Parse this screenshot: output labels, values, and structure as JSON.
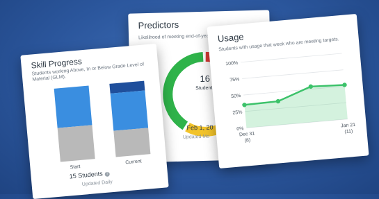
{
  "predictors": {
    "title": "Predictors",
    "subtitle": "Likelihood of meeting end-of-year, p benchmark.",
    "center_value": "16",
    "center_label": "Students",
    "date": "Feb 1, 20",
    "updated": "Updated Mo",
    "colors": {
      "green": "#2fb34a",
      "yellow": "#f2c32a",
      "red": "#d93b35"
    }
  },
  "usage": {
    "title": "Usage",
    "subtitle": "Students with usage that week who are meeting targets.",
    "chart_data": {
      "type": "area",
      "y_ticks": [
        "100%",
        "75%",
        "50%",
        "25%",
        "0%"
      ],
      "ylim": [
        0,
        100
      ],
      "x_labels": [
        {
          "date": "Dec 31",
          "count": "(8)"
        },
        {
          "date": "Jan 21",
          "count": "(11)"
        }
      ],
      "series": [
        {
          "values": [
            35,
            36,
            54,
            52
          ]
        }
      ],
      "color": "#3cc26a"
    }
  },
  "skill": {
    "title": "Skill Progress",
    "subtitle": "Students working Above, In or Below Grade Level of Material (GLM).",
    "chart_data": {
      "type": "bar",
      "categories": [
        "Start",
        "Current"
      ],
      "segments": {
        "Start": {
          "below": 0.46,
          "in": 0.54,
          "above": 0
        },
        "Current": {
          "below": 0.36,
          "in": 0.51,
          "above": 0.13
        }
      },
      "colors": {
        "below": "#b9b9b9",
        "in": "#3a8ee0",
        "above": "#1f4f9c"
      }
    },
    "count_label": "15 Students",
    "help_icon": "question-circle-icon",
    "updated": "Updated Daily"
  }
}
